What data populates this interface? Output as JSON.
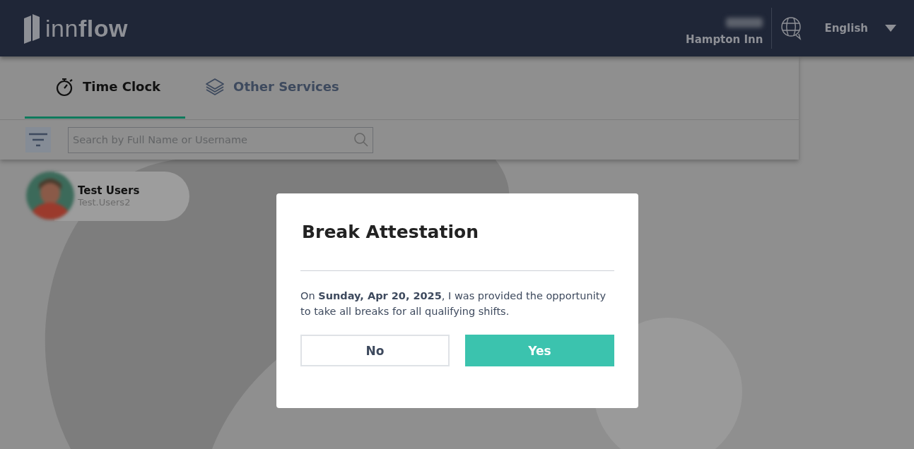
{
  "header": {
    "logo": "inn**flow**",
    "property": "Hampton Inn",
    "language": "English"
  },
  "tabs": [
    {
      "label": "Time Clock",
      "kind": "stopwatch",
      "selected": true
    },
    {
      "label": "Other Services",
      "kind": "layers",
      "selected": false
    }
  ],
  "search": {
    "placeholder": "Search by Full Name or Username"
  },
  "users": [
    {
      "name": "Test Users",
      "username": "Test.Users2"
    }
  ],
  "dialog": {
    "title": "Break Attestation",
    "message": "On **Sunday, Apr 20, 2025**, I was provided the opportunity to take all breaks for all qualifying shifts.",
    "buttons": [
      {
        "label": "No",
        "kind": "secondary"
      },
      {
        "label": "Yes",
        "kind": "primary"
      }
    ]
  }
}
